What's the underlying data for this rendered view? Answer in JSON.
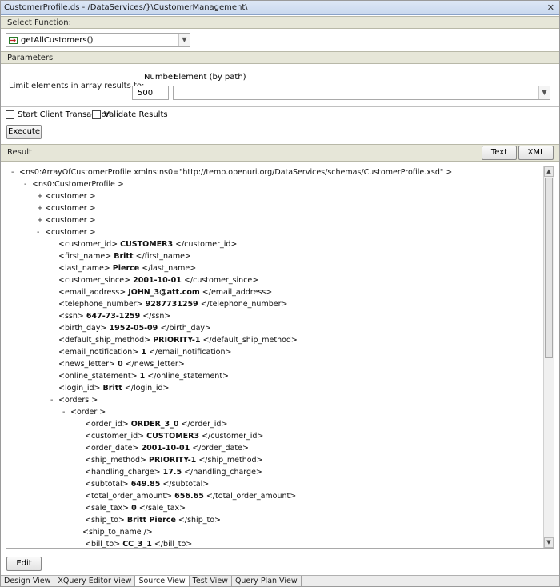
{
  "window": {
    "title": "CustomerProfile.ds - /DataServices/}\\CustomerManagement\\",
    "close_glyph": "✕"
  },
  "select_function": {
    "header": "Select Function:",
    "selected": "getAllCustomers()"
  },
  "parameters": {
    "header": "Parameters",
    "limit_label": "Limit elements in array results to:",
    "number_label": "Number",
    "element_label": "Element (by path)",
    "number_value": "500",
    "element_value": ""
  },
  "options": {
    "start_client_transaction": "Start Client Transaction",
    "validate_results": "Validate Results"
  },
  "execute_label": "Execute",
  "result": {
    "header": "Result",
    "text_button": "Text",
    "xml_button": "XML",
    "lines": [
      {
        "indent": 0,
        "exp": "-",
        "text": "<ns0:ArrayOfCustomerProfile xmlns:ns0=\"http://temp.openuri.org/DataServices/schemas/CustomerProfile.xsd\" >"
      },
      {
        "indent": 1,
        "exp": "-",
        "text": "<ns0:CustomerProfile >"
      },
      {
        "indent": 2,
        "exp": "+",
        "text": "<customer >"
      },
      {
        "indent": 2,
        "exp": "+",
        "text": "<customer >"
      },
      {
        "indent": 2,
        "exp": "+",
        "text": "<customer >"
      },
      {
        "indent": 2,
        "exp": "-",
        "text": "<customer >"
      },
      {
        "indent": 3,
        "open": "<customer_id>",
        "value": "CUSTOMER3",
        "close": "</customer_id>"
      },
      {
        "indent": 3,
        "open": "<first_name>",
        "value": "Britt",
        "close": "</first_name>"
      },
      {
        "indent": 3,
        "open": "<last_name>",
        "value": "Pierce",
        "close": "</last_name>"
      },
      {
        "indent": 3,
        "open": "<customer_since>",
        "value": "2001-10-01",
        "close": "</customer_since>"
      },
      {
        "indent": 3,
        "open": "<email_address>",
        "value": "JOHN_3@att.com",
        "close": "</email_address>"
      },
      {
        "indent": 3,
        "open": "<telephone_number>",
        "value": "9287731259",
        "close": "</telephone_number>"
      },
      {
        "indent": 3,
        "open": "<ssn>",
        "value": "647-73-1259",
        "close": "</ssn>"
      },
      {
        "indent": 3,
        "open": "<birth_day>",
        "value": "1952-05-09",
        "close": "</birth_day>"
      },
      {
        "indent": 3,
        "open": "<default_ship_method>",
        "value": "PRIORITY-1",
        "close": "</default_ship_method>"
      },
      {
        "indent": 3,
        "open": "<email_notification>",
        "value": "1",
        "close": "</email_notification>"
      },
      {
        "indent": 3,
        "open": "<news_letter>",
        "value": "0",
        "close": "</news_letter>"
      },
      {
        "indent": 3,
        "open": "<online_statement>",
        "value": "1",
        "close": "</online_statement>"
      },
      {
        "indent": 3,
        "open": "<login_id>",
        "value": "Britt",
        "close": "</login_id>"
      },
      {
        "indent": 3,
        "exp": "-",
        "text": "<orders >"
      },
      {
        "indent": 4,
        "exp": "-",
        "text": "<order >"
      },
      {
        "indent": 5,
        "open": "<order_id>",
        "value": "ORDER_3_0",
        "close": "</order_id>"
      },
      {
        "indent": 5,
        "open": "<customer_id>",
        "value": "CUSTOMER3",
        "close": "</customer_id>"
      },
      {
        "indent": 5,
        "open": "<order_date>",
        "value": "2001-10-01",
        "close": "</order_date>"
      },
      {
        "indent": 5,
        "open": "<ship_method>",
        "value": "PRIORITY-1",
        "close": "</ship_method>"
      },
      {
        "indent": 5,
        "open": "<handling_charge>",
        "value": "17.5",
        "close": "</handling_charge>"
      },
      {
        "indent": 5,
        "open": "<subtotal>",
        "value": "649.85",
        "close": "</subtotal>"
      },
      {
        "indent": 5,
        "open": "<total_order_amount>",
        "value": "656.65",
        "close": "</total_order_amount>"
      },
      {
        "indent": 5,
        "open": "<sale_tax>",
        "value": "0",
        "close": "</sale_tax>"
      },
      {
        "indent": 5,
        "open": "<ship_to>",
        "value": "Britt Pierce",
        "close": "</ship_to>"
      },
      {
        "indent": 5,
        "text": "<ship_to_name />",
        "shift": -1
      },
      {
        "indent": 5,
        "open": "<bill_to>",
        "value": "CC_3_1",
        "close": "</bill_to>"
      }
    ]
  },
  "edit_label": "Edit",
  "tabs": [
    {
      "label": "Design View",
      "active": false
    },
    {
      "label": "XQuery Editor View",
      "active": false
    },
    {
      "label": "Source View",
      "active": true
    },
    {
      "label": "Test View",
      "active": false
    },
    {
      "label": "Query Plan View",
      "active": false
    }
  ],
  "colors": {
    "section_header": "#e6e6d8",
    "titlebar": "#c9d8ee"
  },
  "icons": {
    "function": "function-icon",
    "dropdown": "chevron-down-icon"
  }
}
